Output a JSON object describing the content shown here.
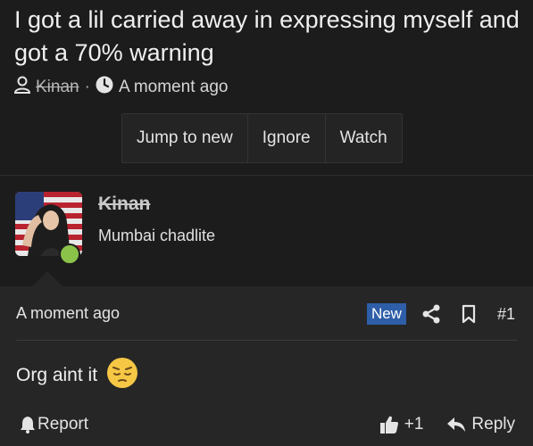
{
  "thread": {
    "title": "I got a lil carried away in expressing myself and got a 70% warning",
    "author": "Kinan",
    "separator": "·",
    "time": "A moment ago"
  },
  "actions": {
    "jump_to_new": "Jump to new",
    "ignore": "Ignore",
    "watch": "Watch"
  },
  "user": {
    "name": "Kinan",
    "title": "Mumbai chadlite",
    "status_color": "#8bc34a"
  },
  "post": {
    "time": "A moment ago",
    "badge": "New",
    "number": "#1",
    "content": "Org aint it",
    "emoji": "pensive-face"
  },
  "footer": {
    "report": "Report",
    "likes": "+1",
    "reply": "Reply"
  },
  "colors": {
    "background": "#1c1c1c",
    "post_background": "#262626",
    "badge": "#2e5ea8"
  }
}
